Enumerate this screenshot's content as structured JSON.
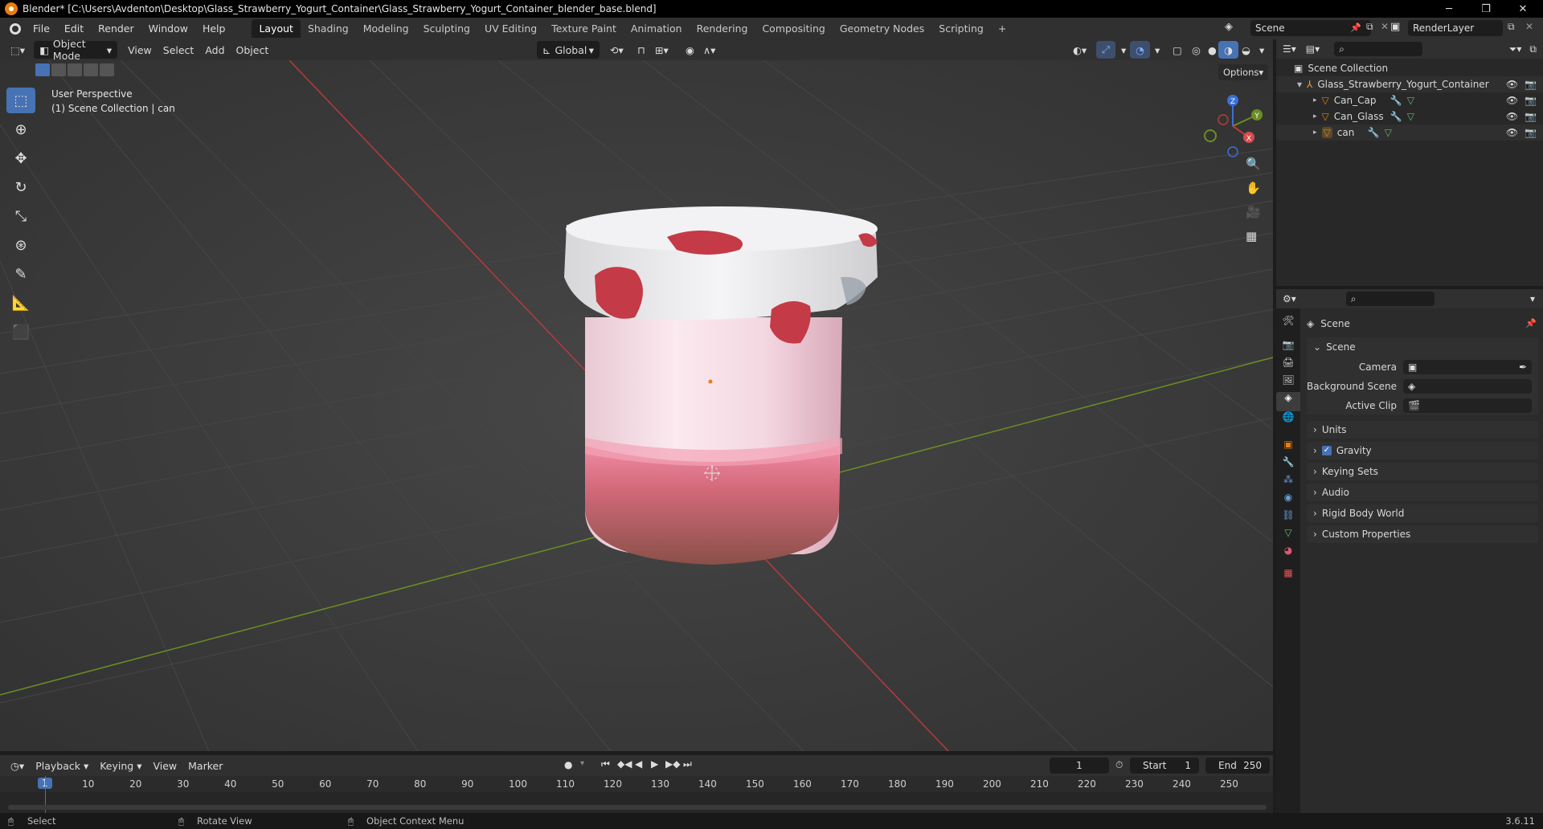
{
  "window": {
    "title": "Blender* [C:\\Users\\Avdenton\\Desktop\\Glass_Strawberry_Yogurt_Container\\Glass_Strawberry_Yogurt_Container_blender_base.blend]",
    "minimize": "─",
    "maximize": "❐",
    "close": "✕"
  },
  "menubar": {
    "menus": [
      "File",
      "Edit",
      "Render",
      "Window",
      "Help"
    ],
    "workspaces": [
      "Layout",
      "Shading",
      "Modeling",
      "Sculpting",
      "UV Editing",
      "Texture Paint",
      "Animation",
      "Rendering",
      "Compositing",
      "Geometry Nodes",
      "Scripting"
    ],
    "active_workspace": "Layout",
    "add_tab": "+",
    "scene": "Scene",
    "view_layer": "RenderLayer"
  },
  "viewport_header": {
    "mode": "Object Mode",
    "menus": [
      "View",
      "Select",
      "Add",
      "Object"
    ],
    "transform_orientation": "Global",
    "options_label": "Options"
  },
  "viewport": {
    "perspective": "User Perspective",
    "collection_info": "(1) Scene Collection | can",
    "axes": {
      "x": "X",
      "y": "Y",
      "z": "Z"
    }
  },
  "outliner": {
    "root": "Scene Collection",
    "collection": "Glass_Strawberry_Yogurt_Container",
    "objects": [
      "Can_Cap",
      "Can_Glass",
      "can"
    ]
  },
  "properties": {
    "context_title": "Scene",
    "section_title": "Scene",
    "fields": [
      {
        "label": "Camera",
        "value": ""
      },
      {
        "label": "Background Scene",
        "value": ""
      },
      {
        "label": "Active Clip",
        "value": ""
      }
    ],
    "panels": [
      "Units",
      "Gravity",
      "Keying Sets",
      "Audio",
      "Rigid Body World",
      "Custom Properties"
    ],
    "gravity_enabled": true
  },
  "timeline": {
    "menus": [
      "Playback",
      "Keying",
      "View",
      "Marker"
    ],
    "current_frame": "1",
    "start_label": "Start",
    "start": "1",
    "end_label": "End",
    "end": "250",
    "ruler": [
      "10",
      "20",
      "30",
      "40",
      "50",
      "60",
      "70",
      "80",
      "90",
      "100",
      "110",
      "120",
      "130",
      "140",
      "150",
      "160",
      "170",
      "180",
      "190",
      "200",
      "210",
      "220",
      "230",
      "240",
      "250"
    ],
    "playhead": "1"
  },
  "statusbar": {
    "left": "Select",
    "middle": "Rotate View",
    "right": "Object Context Menu",
    "version": "3.6.11"
  },
  "colors": {
    "accent": "#4772b3",
    "x_axis": "#b83a3a",
    "y_axis": "#6b8e23",
    "z_axis": "#3a6fd6",
    "object_orange": "#e87d0d"
  }
}
